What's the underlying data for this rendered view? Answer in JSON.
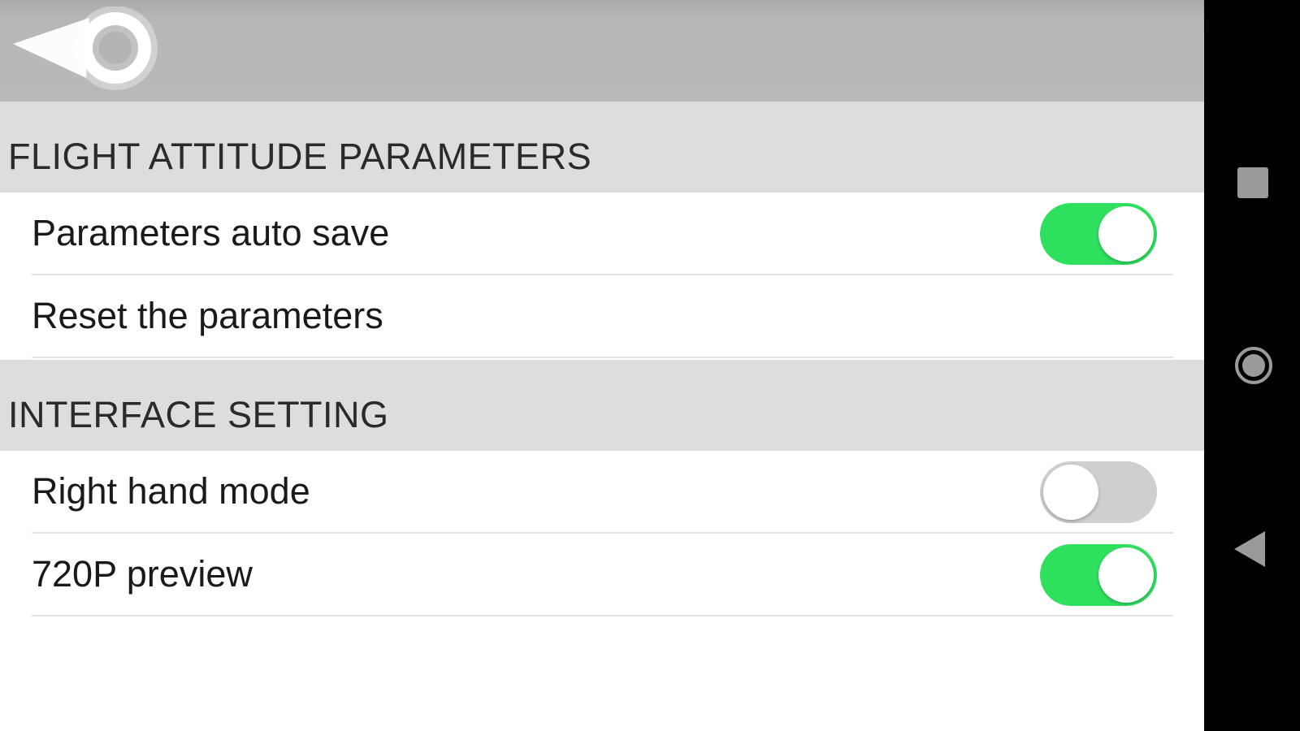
{
  "header": {
    "back_icon": "back-arrow-icon"
  },
  "sections": [
    {
      "title": "FLIGHT ATTITUDE PARAMETERS",
      "rows": [
        {
          "label": "Parameters auto save",
          "toggle": true
        },
        {
          "label": "Reset the parameters"
        }
      ]
    },
    {
      "title": "INTERFACE SETTING",
      "rows": [
        {
          "label": "Right hand mode",
          "toggle": false
        },
        {
          "label": "720P preview",
          "toggle": true
        }
      ]
    }
  ],
  "navigation": {
    "icons": [
      "recents-square-icon",
      "home-circle-icon",
      "back-triangle-icon"
    ]
  },
  "colors": {
    "toggle_on": "#2fe05f",
    "toggle_off": "#cfcfcf",
    "header_bar": "#b9b9b9",
    "section_bg": "#dddddd",
    "nav_bar": "#000000"
  }
}
